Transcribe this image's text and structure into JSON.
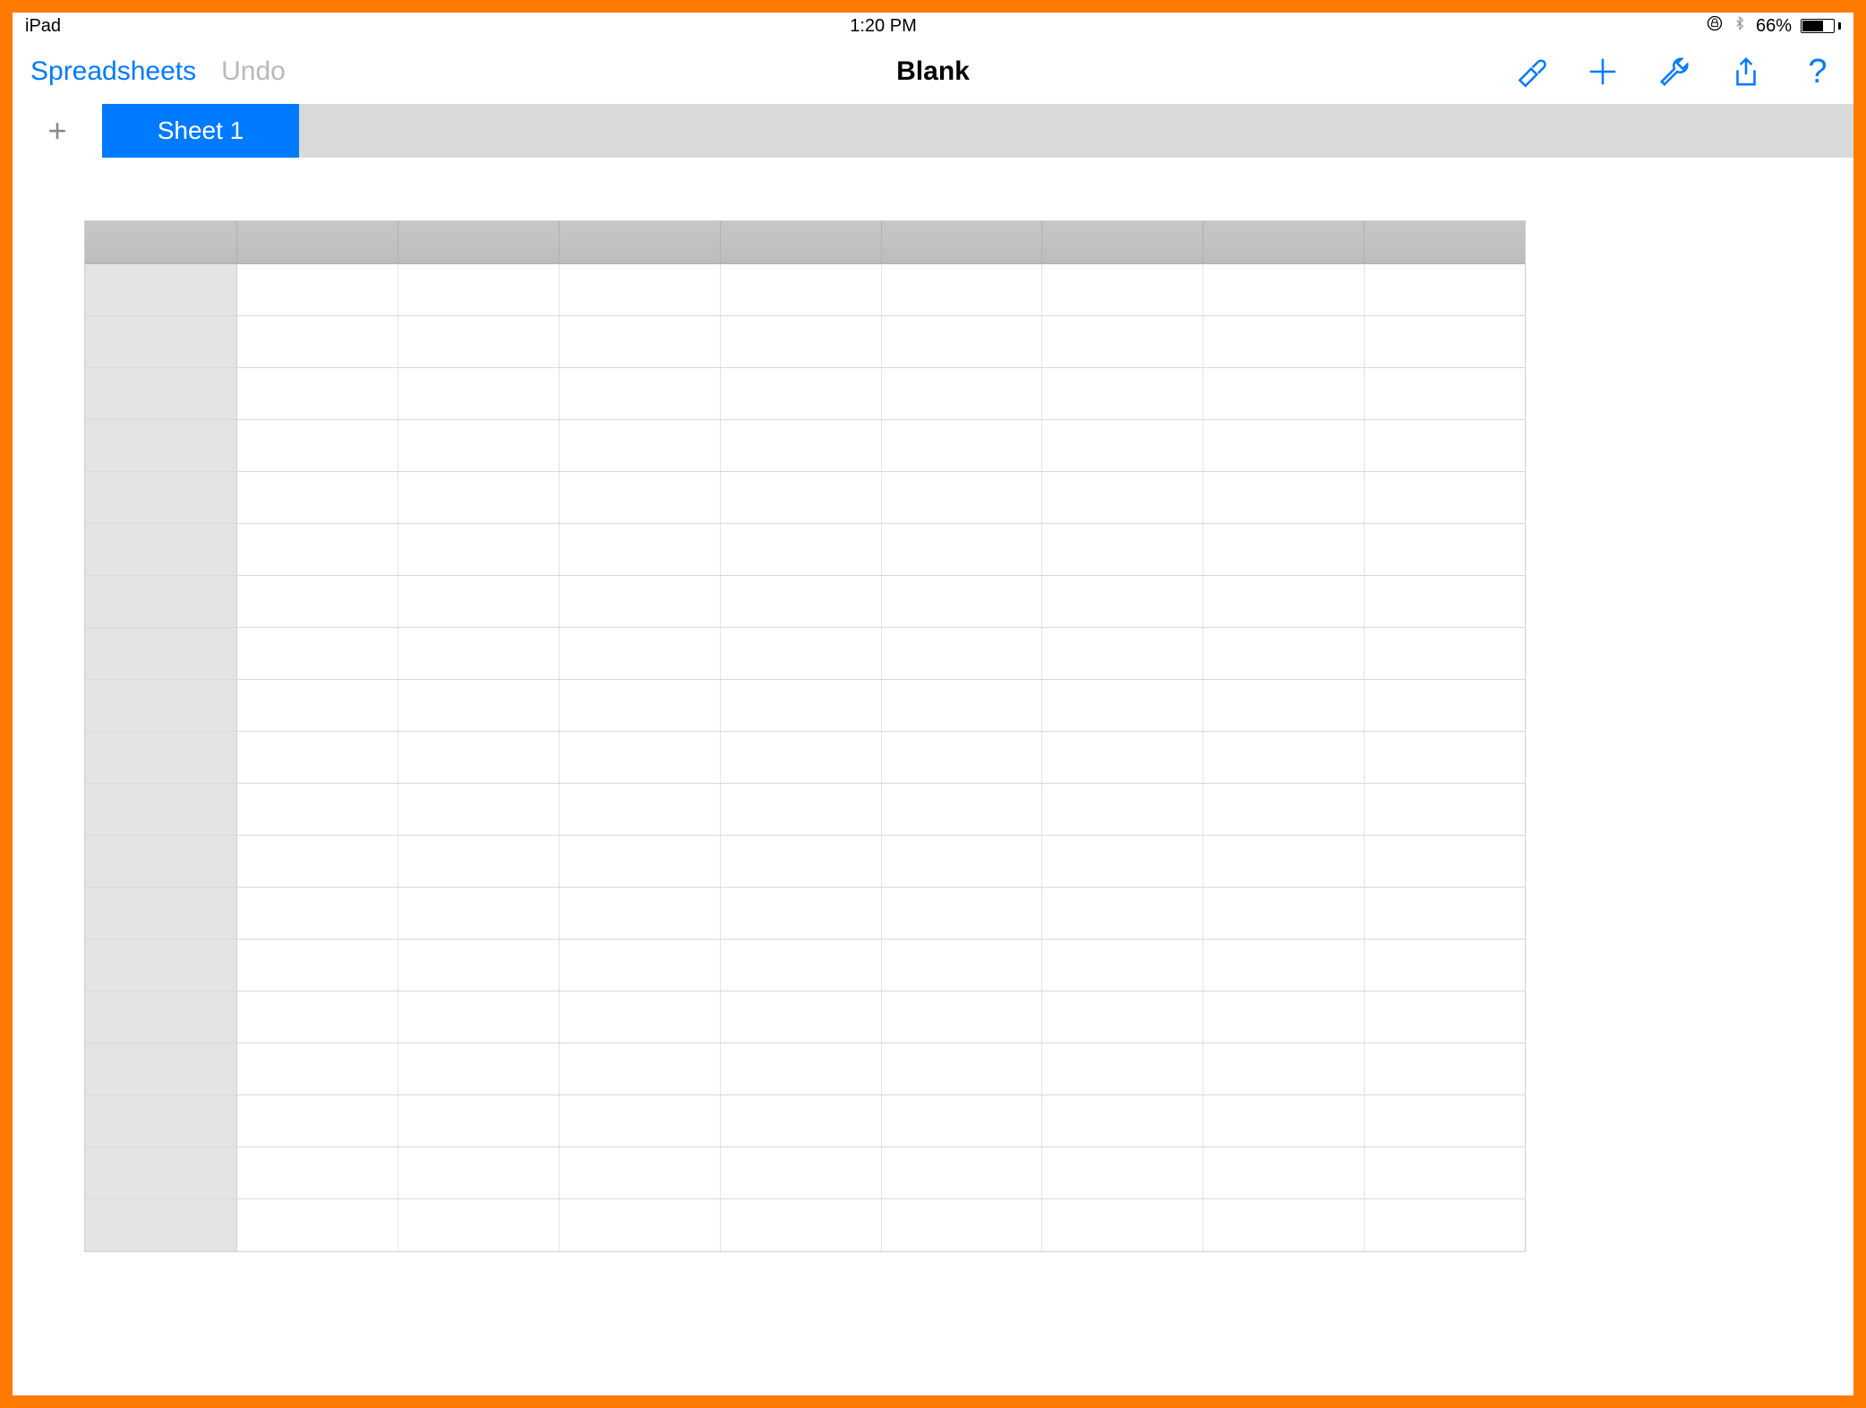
{
  "status": {
    "device": "iPad",
    "time": "1:20 PM",
    "lock_icon": "orientation-lock-icon",
    "bluetooth_icon": "bluetooth-icon",
    "battery_percent": "66%"
  },
  "toolbar": {
    "back_label": "Spreadsheets",
    "undo_label": "Undo",
    "title": "Blank",
    "icons": {
      "format": "format-brush-icon",
      "add": "add-icon",
      "tools": "wrench-icon",
      "share": "share-icon",
      "help": "help-icon"
    }
  },
  "tabs": {
    "add_label": "+",
    "items": [
      {
        "label": "Sheet 1",
        "active": true
      }
    ]
  },
  "grid": {
    "columns": 8,
    "rows": 19
  },
  "colors": {
    "accent": "#007aff",
    "frame": "#ff7a00"
  }
}
